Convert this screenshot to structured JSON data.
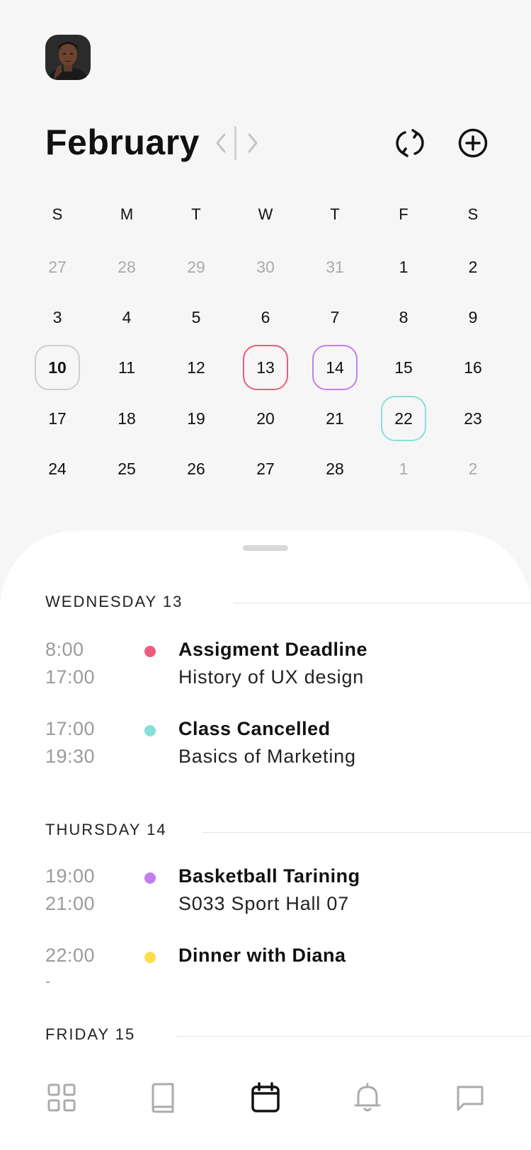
{
  "header": {
    "avatar_name": "avatar",
    "month": "February"
  },
  "icons": {
    "prev": "chevron-left-icon",
    "next": "chevron-right-icon",
    "sync": "sync-icon",
    "add": "add-circle-icon"
  },
  "calendar": {
    "weekdays": [
      "S",
      "M",
      "T",
      "W",
      "T",
      "F",
      "S"
    ],
    "weeks": [
      [
        {
          "d": "27",
          "muted": true
        },
        {
          "d": "28",
          "muted": true
        },
        {
          "d": "29",
          "muted": true
        },
        {
          "d": "30",
          "muted": true
        },
        {
          "d": "31",
          "muted": true
        },
        {
          "d": "1"
        },
        {
          "d": "2"
        }
      ],
      [
        {
          "d": "3"
        },
        {
          "d": "4"
        },
        {
          "d": "5"
        },
        {
          "d": "6"
        },
        {
          "d": "7"
        },
        {
          "d": "8"
        },
        {
          "d": "9"
        }
      ],
      [
        {
          "d": "10",
          "mark": "today"
        },
        {
          "d": "11"
        },
        {
          "d": "12"
        },
        {
          "d": "13",
          "mark": "pink"
        },
        {
          "d": "14",
          "mark": "purple"
        },
        {
          "d": "15"
        },
        {
          "d": "16"
        }
      ],
      [
        {
          "d": "17"
        },
        {
          "d": "18"
        },
        {
          "d": "19"
        },
        {
          "d": "20"
        },
        {
          "d": "21"
        },
        {
          "d": "22",
          "mark": "teal"
        },
        {
          "d": "23"
        }
      ],
      [
        {
          "d": "24"
        },
        {
          "d": "25"
        },
        {
          "d": "26"
        },
        {
          "d": "27"
        },
        {
          "d": "28"
        },
        {
          "d": "1",
          "muted": true
        },
        {
          "d": "2",
          "muted": true
        }
      ]
    ]
  },
  "colors": {
    "pink": "#ef5a7e",
    "teal": "#86e0d8",
    "purple": "#c47ef0",
    "yellow": "#ffdb4d"
  },
  "agenda": {
    "wed_title": "WEDNESDAY 13",
    "thu_title": "THURSDAY 14",
    "fri_title": "FRIDAY 15",
    "events": [
      {
        "start": "8:00",
        "end": "17:00",
        "title": "Assigment Deadline",
        "subtitle": "History of UX design",
        "color": "pink"
      },
      {
        "start": "17:00",
        "end": "19:30",
        "title": "Class Cancelled",
        "subtitle": "Basics of Marketing",
        "color": "teal"
      },
      {
        "start": "19:00",
        "end": "21:00",
        "title": "Basketball Tarining",
        "subtitle": "S033 Sport Hall 07",
        "color": "purple"
      },
      {
        "start": "22:00",
        "end": "-",
        "title": "Dinner with Diana",
        "subtitle": "",
        "color": "yellow"
      }
    ]
  },
  "tabbar": {
    "items": [
      {
        "icon": "grid-icon",
        "active": false
      },
      {
        "icon": "book-icon",
        "active": false
      },
      {
        "icon": "calendar-icon",
        "active": true
      },
      {
        "icon": "bell-icon",
        "active": false
      },
      {
        "icon": "chat-icon",
        "active": false
      }
    ]
  }
}
